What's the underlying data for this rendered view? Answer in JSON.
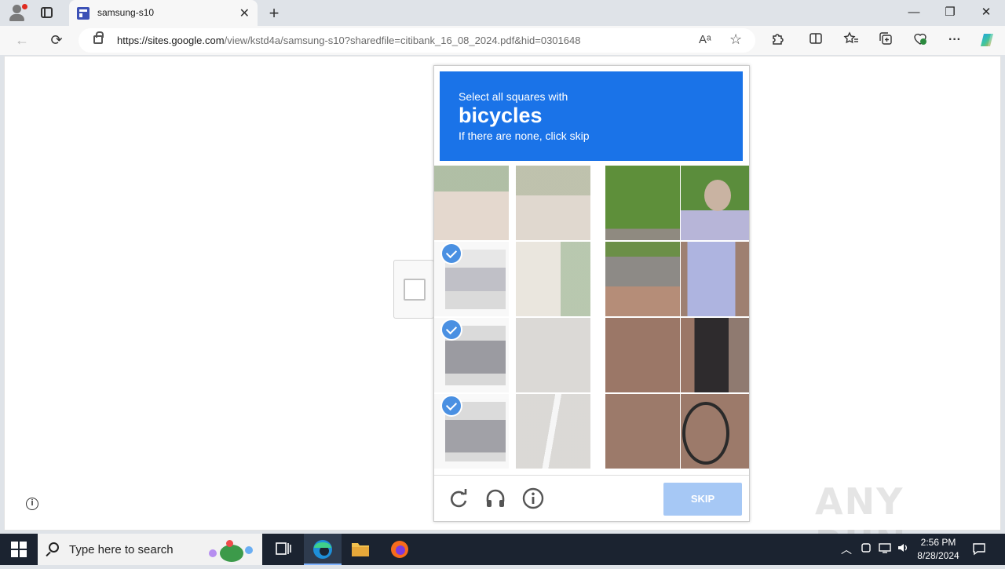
{
  "browser": {
    "tab_title": "samsung-s10",
    "url_host": "https://sites.google.com",
    "url_path": "/view/kstd4a/samsung-s10?sharedfile=citibank_16_08_2024.pdf&hid=0301648",
    "new_tab": "+",
    "close_tab": "✕",
    "minimize": "—",
    "restore": "❐",
    "close_window": "✕",
    "back": "←",
    "refresh": "⟳",
    "read_aloud": "Aᵃ",
    "favorite": "☆",
    "more": "···"
  },
  "captcha": {
    "instruction_line1": "Select all squares with",
    "target_word": "bicycles",
    "instruction_line3": "If there are none, click skip",
    "skip_label": "SKIP",
    "accent_color": "#1a73e8",
    "selected_tiles": [
      0,
      1,
      2
    ]
  },
  "watermark": "ANY RUN",
  "taskbar": {
    "search_placeholder": "Type here to search",
    "time": "2:56 PM",
    "date": "8/28/2024"
  }
}
